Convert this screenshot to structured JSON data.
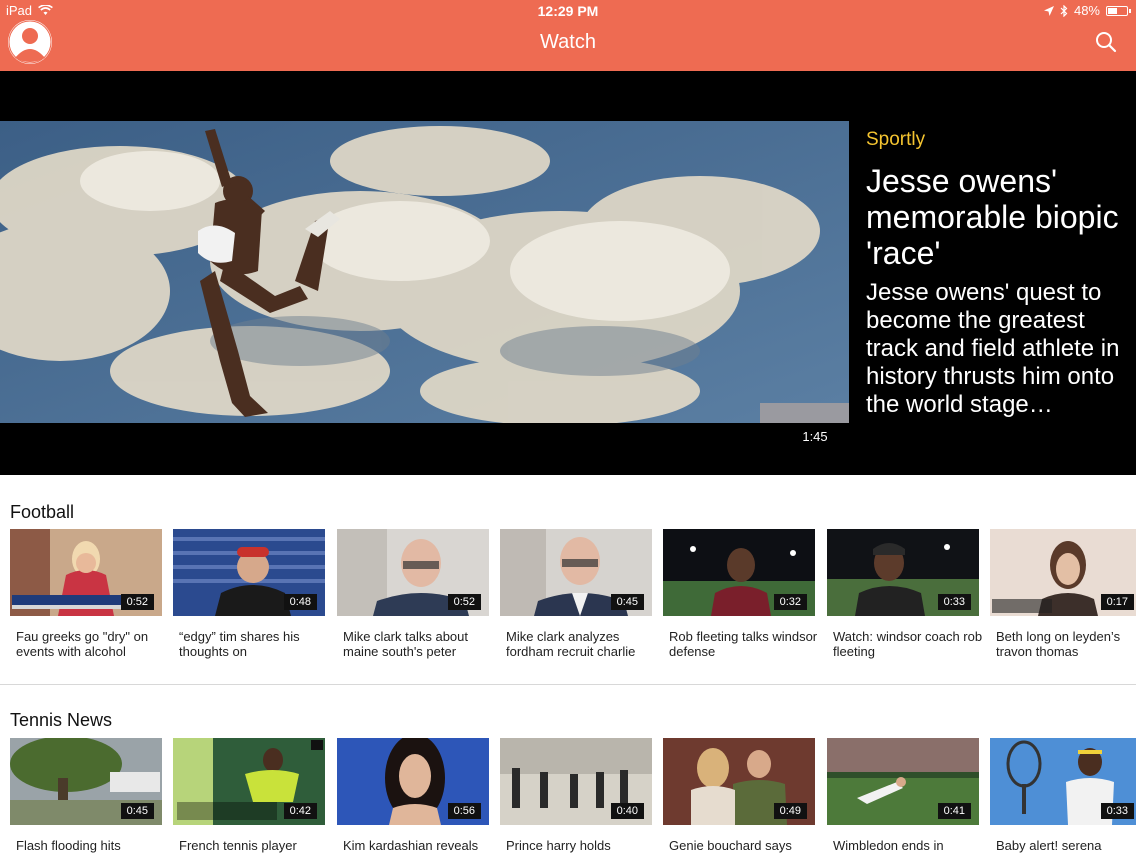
{
  "status": {
    "device": "iPad",
    "time": "12:29 PM",
    "battery": "48%",
    "battery_level": 0.48
  },
  "nav": {
    "title": "Watch"
  },
  "hero": {
    "category": "Sportly",
    "title": "Jesse owens' memorable biopic 'race'",
    "description": "Jesse owens' quest to become the greatest track and field athlete in history thrusts him onto the world stage…",
    "duration": "1:45"
  },
  "sections": [
    {
      "title": "Football",
      "videos": [
        {
          "title": "Fau greeks go \"dry\" on events with alcohol",
          "duration": "0:52"
        },
        {
          "title": "“edgy” tim shares his thoughts on",
          "duration": "0:48"
        },
        {
          "title": "Mike clark talks about maine south's peter",
          "duration": "0:52"
        },
        {
          "title": "Mike clark analyzes fordham recruit charlie",
          "duration": "0:45"
        },
        {
          "title": "Rob fleeting talks windsor defense",
          "duration": "0:32"
        },
        {
          "title": "Watch: windsor coach rob fleeting",
          "duration": "0:33"
        },
        {
          "title": "Beth long on leyden’s travon thomas",
          "duration": "0:17"
        }
      ]
    },
    {
      "title": "Tennis News",
      "videos": [
        {
          "title": "Flash flooding hits",
          "duration": "0:45"
        },
        {
          "title": "French tennis player",
          "duration": "0:42"
        },
        {
          "title": "Kim kardashian reveals",
          "duration": "0:56"
        },
        {
          "title": "Prince harry holds",
          "duration": "0:40"
        },
        {
          "title": "Genie bouchard says",
          "duration": "0:49"
        },
        {
          "title": "Wimbledon ends in",
          "duration": "0:41"
        },
        {
          "title": "Baby alert! serena",
          "duration": "0:33"
        }
      ]
    }
  ]
}
